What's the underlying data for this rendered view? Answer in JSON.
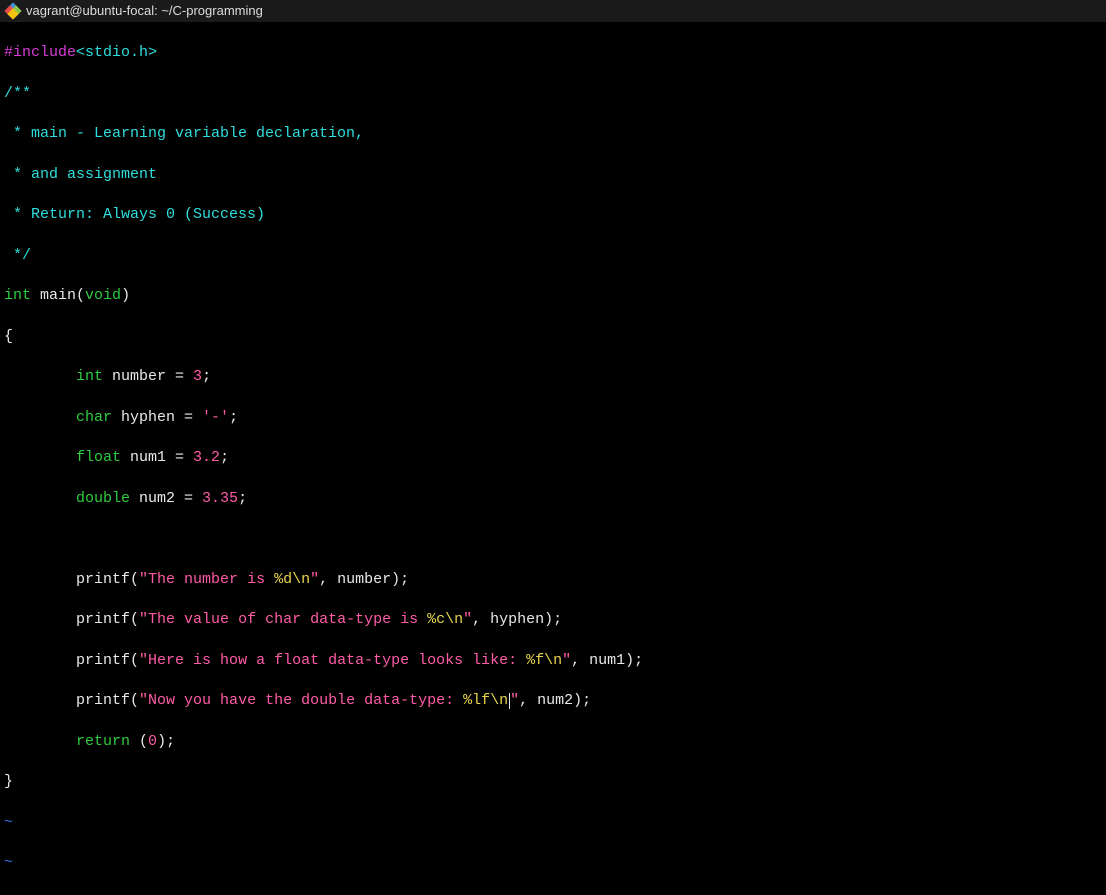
{
  "titlebar": {
    "title": "vagrant@ubuntu-focal: ~/C-programming"
  },
  "code": {
    "include": "#include",
    "header": "<stdio.h>",
    "cmt_open": "/**",
    "cmt_l1": " * main - Learning variable declaration,",
    "cmt_l2": " * and assignment",
    "cmt_l3": " * Return: Always 0 (Success)",
    "cmt_close": " */",
    "kw_int": "int",
    "fn_main": " main",
    "paren_o": "(",
    "kw_void": "void",
    "paren_c": ")",
    "brace_o": "{",
    "indent": "        ",
    "kw_int2": "int",
    "decl_number": " number = ",
    "lit_3": "3",
    "semi": ";",
    "kw_char": "char",
    "decl_hyphen": " hyphen = ",
    "lit_dash": "'-'",
    "kw_float": "float",
    "decl_num1": " num1 = ",
    "lit_3_2": "3.2",
    "kw_double": "double",
    "decl_num2": " num2 = ",
    "lit_3_35": "3.35",
    "printf": "printf",
    "p_o": "(",
    "str1a": "\"The number is ",
    "fmt_d": "%d\\n",
    "str1b": "\"",
    "args1": ", number);",
    "str2a": "\"The value of char data-type is ",
    "fmt_c": "%c\\n",
    "args2": ", hyphen);",
    "str3a": "\"Here is how a float data-type looks like: ",
    "fmt_f": "%f\\n",
    "args3": ", num1);",
    "str4a": "\"Now you have the double data-type: ",
    "fmt_lf": "%lf\\n",
    "args4": ", num2);",
    "kw_return": "return",
    "ret_val": " (",
    "lit_0": "0",
    "ret_end": ");",
    "brace_c": "}",
    "tilde": "~"
  }
}
